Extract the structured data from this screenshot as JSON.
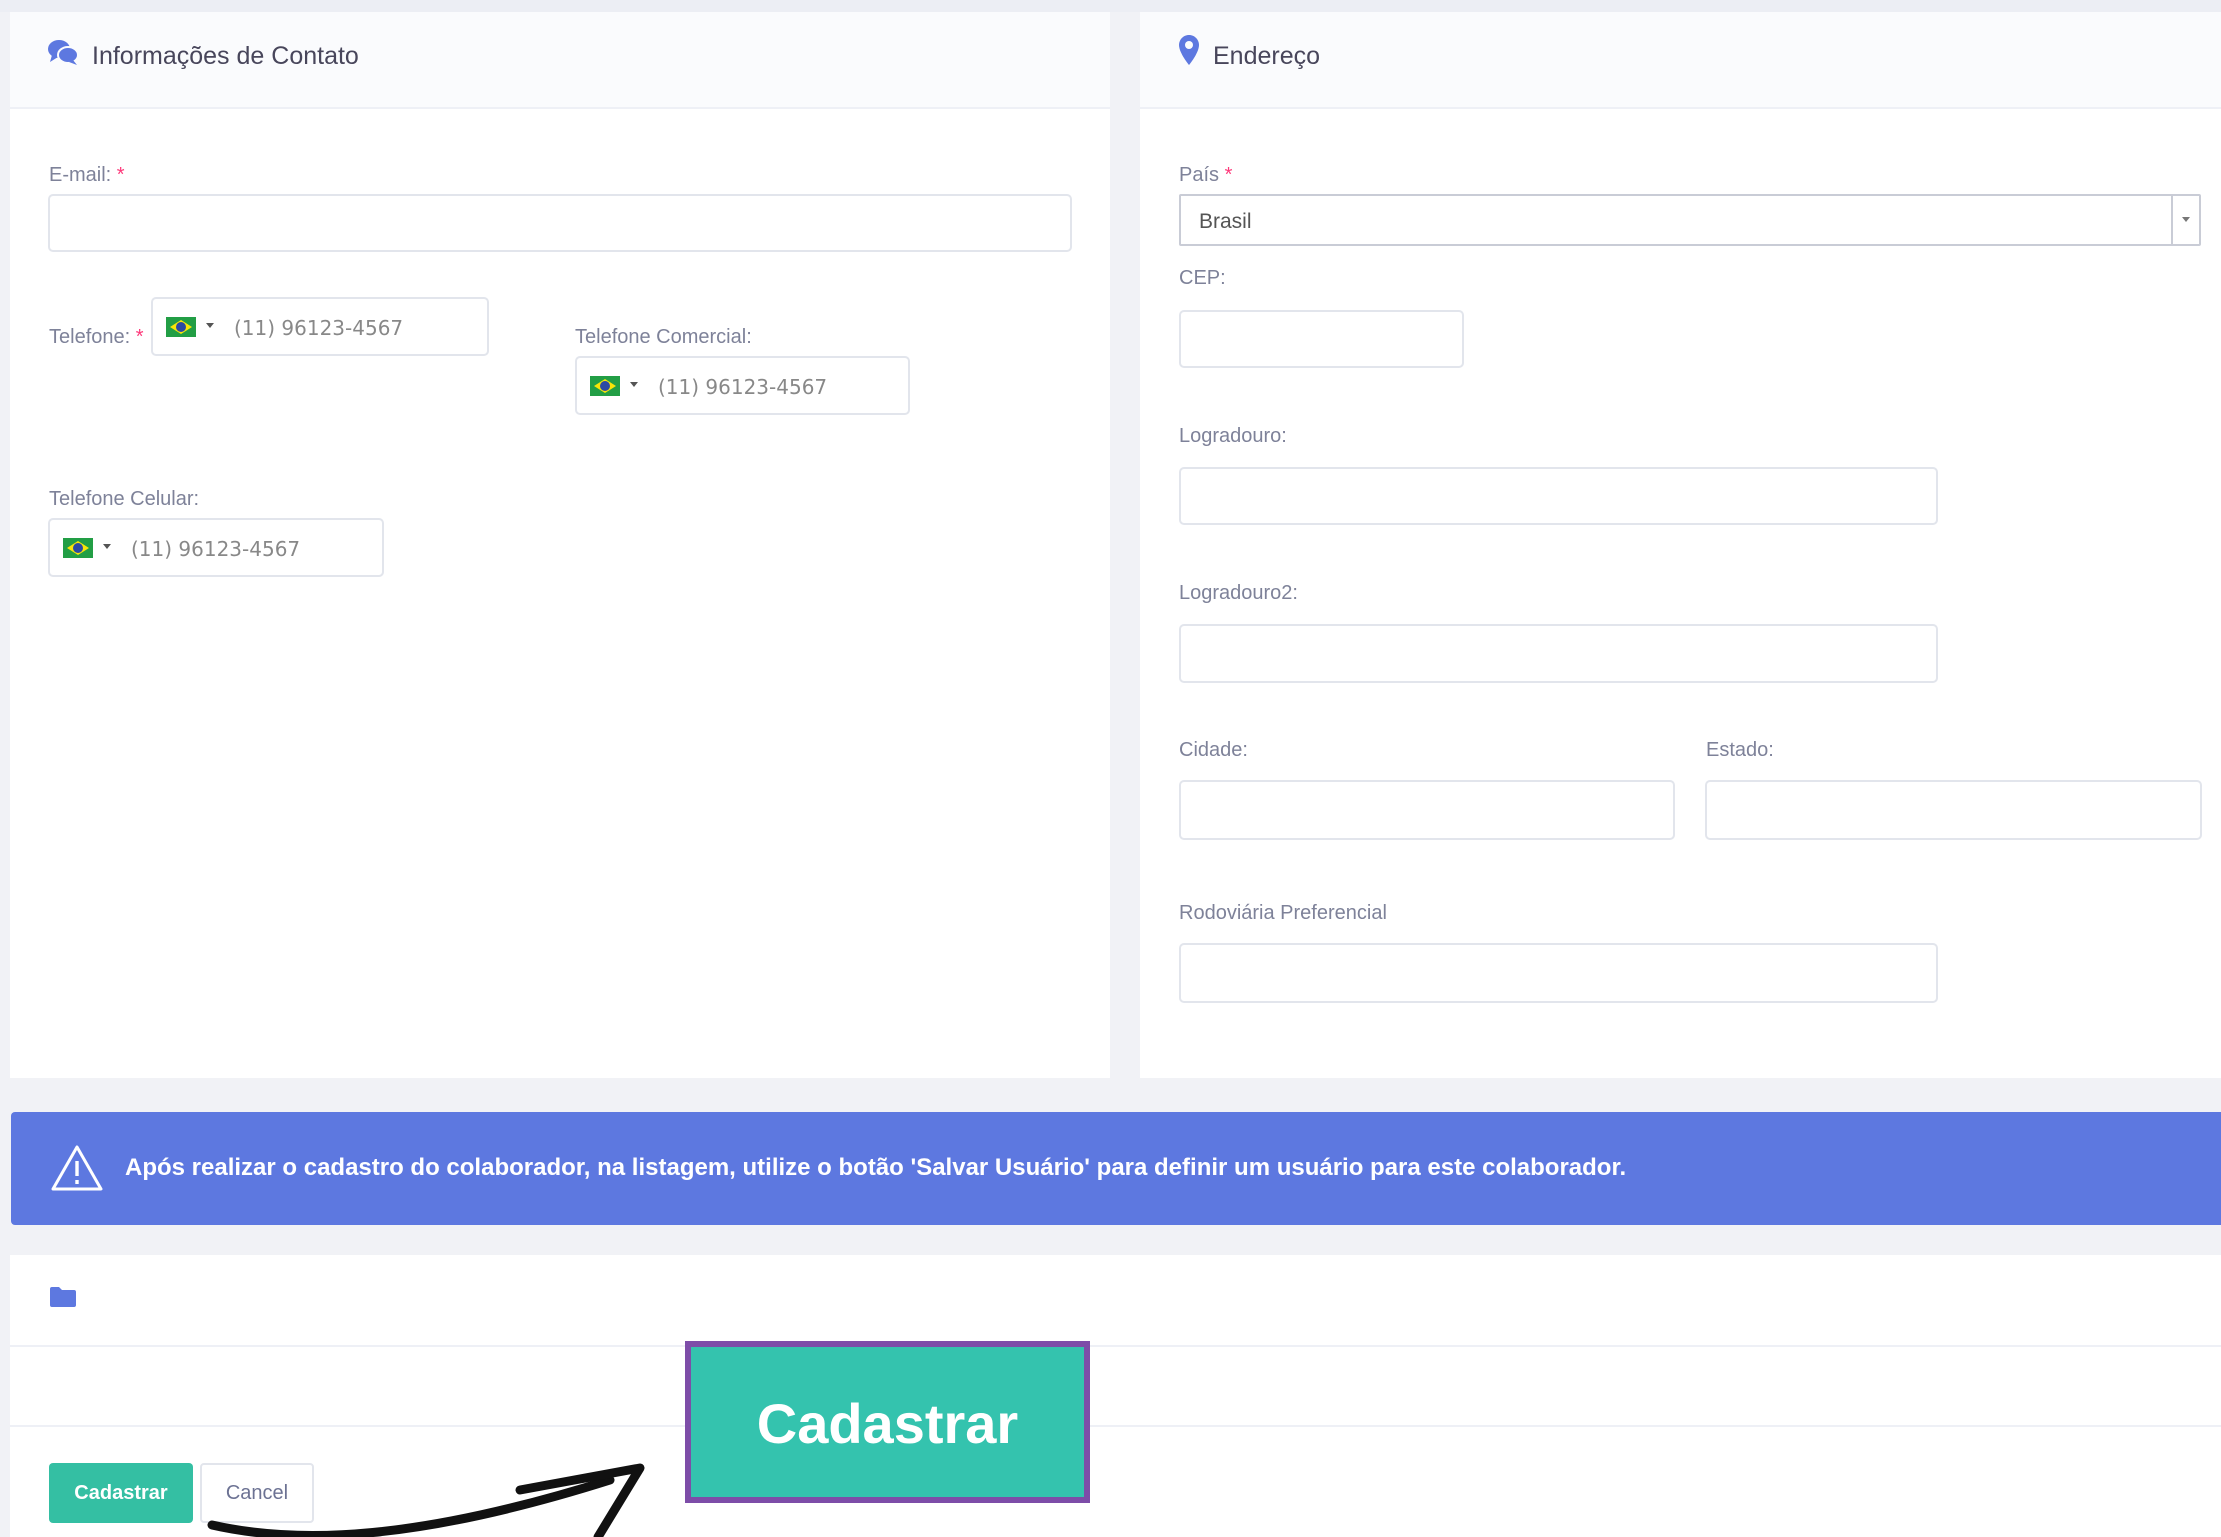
{
  "contact": {
    "title": "Informações de Contato",
    "email_label": "E-mail:",
    "required_mark": "*",
    "phone_label": "Telefone:",
    "phone_commercial_label": "Telefone Comercial:",
    "mobile_label": "Telefone Celular:",
    "phone_placeholder": "(11) 96123-4567"
  },
  "address": {
    "title": "Endereço",
    "country_label": "País",
    "country_value": "Brasil",
    "cep_label": "CEP:",
    "street_label": "Logradouro:",
    "street2_label": "Logradouro2:",
    "city_label": "Cidade:",
    "state_label": "Estado:",
    "bus_label": "Rodoviária Preferencial"
  },
  "alert": {
    "text": "Após realizar o cadastro do colaborador, na listagem, utilize o botão 'Salvar Usuário' para definir um usuário para este colaborador."
  },
  "actions": {
    "submit_label": "Cadastrar",
    "cancel_label": "Cancel",
    "callout_label": "Cadastrar"
  },
  "colors": {
    "accent": "#5d78e0",
    "success": "#34bfa3",
    "callout_border": "#7d4da8",
    "required": "#fd397a"
  },
  "icons": {
    "contact": "comments-icon",
    "address": "map-marker-icon",
    "alert": "warning-triangle-icon",
    "folder": "folder-icon",
    "arrow": "hand-drawn-arrow-icon"
  }
}
